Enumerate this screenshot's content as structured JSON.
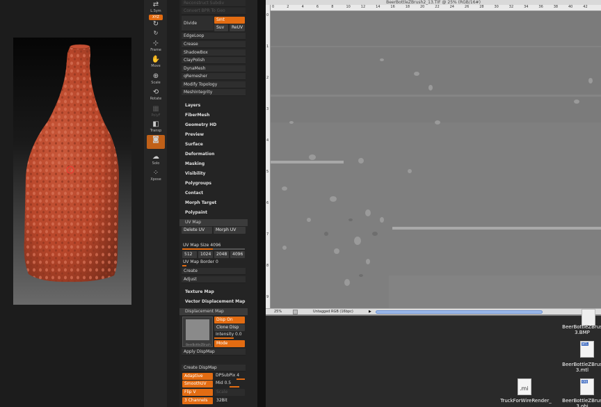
{
  "zbrush": {
    "shelf": {
      "lsym": "L.Sym",
      "xyz": "XYZ",
      "frame": "Frame",
      "move": "Move",
      "scale": "Scale",
      "rotate": "Rotate",
      "polyf": "PolyF",
      "transp": "Transp",
      "solo": "Solo",
      "xpose": "Xpose"
    },
    "palette": {
      "top_faded_1": "Reconstruct Subdiv",
      "top_faded_2": "Convert BPR To Geo",
      "divide": "Divide",
      "smt": "Smt",
      "suv": "Suv",
      "reuv": "ReUV",
      "geometry_items": [
        "EdgeLoop",
        "Crease",
        "ShadowBox",
        "ClayPolish",
        "DynaMesh",
        "qRemesher",
        "Modify Topology",
        "MeshIntegrity"
      ],
      "subpalettes": [
        "Layers",
        "FiberMesh",
        "Geometry HD",
        "Preview",
        "Surface",
        "Deformation",
        "Masking",
        "Visibility",
        "Polygroups",
        "Contact",
        "Morph Target",
        "Polypaint"
      ],
      "uvmap": {
        "header": "UV Map",
        "delete_uv": "Delete UV",
        "morph_uv": "Morph UV",
        "size_label": "UV Map Size",
        "size_value": "4096",
        "sizes": [
          "512",
          "1024",
          "2048",
          "4096"
        ],
        "border_label": "UV Map Border",
        "border_value": "0",
        "create": "Create",
        "adjust": "Adjust"
      },
      "texture_map": "Texture Map",
      "vector_disp_map": "Vector Displacement Map",
      "dispmap": {
        "header": "Displacement Map",
        "thumb_label": "BeerBottleZBrush",
        "disp_on": "Disp On",
        "clone_disp": "Clone Disp",
        "intensity_label": "Intensity",
        "intensity_value": "0.0",
        "mode": "Mode",
        "apply": "Apply DispMap",
        "create": "Create DispMap",
        "adaptive": "Adaptive",
        "dpsubpix_label": "DPSubPix",
        "dpsubpix_value": "4",
        "smoothuv": "SmoothUV",
        "mid_label": "Mid",
        "mid_value": "0.5",
        "flipv": "Flip V",
        "scale": "Scale",
        "channels": "3 Channels",
        "bit": "32Bit"
      }
    }
  },
  "photoshop": {
    "title": "BeerBottleZBrush2_13.TIF @ 25% (RGB/16#)",
    "ruler_top": [
      "0",
      "2",
      "4",
      "6",
      "8",
      "10",
      "12",
      "14",
      "16",
      "18",
      "20",
      "22",
      "24",
      "26",
      "28",
      "30",
      "32",
      "34",
      "36",
      "38",
      "40",
      "42"
    ],
    "ruler_left": [
      "0",
      "1",
      "2",
      "3",
      "4",
      "5",
      "6",
      "7",
      "8",
      "9"
    ],
    "zoom": "25%",
    "profile": "Untagged RGB (16bpc)"
  },
  "desktop": {
    "files": [
      {
        "name": "BeerBottleZBrus\n3.BMP",
        "type": "BMP"
      },
      {
        "name": "BeerBottleZBrus\n3.mtl",
        "type": "MTL"
      },
      {
        "name": "BeerBottleZBrus\n3.obj",
        "type": "OBJ"
      },
      {
        "name": "TruckForWireRender_",
        "type": ".mi"
      }
    ]
  },
  "colors": {
    "accent": "#e36c12",
    "bottle": "#b8462a"
  }
}
